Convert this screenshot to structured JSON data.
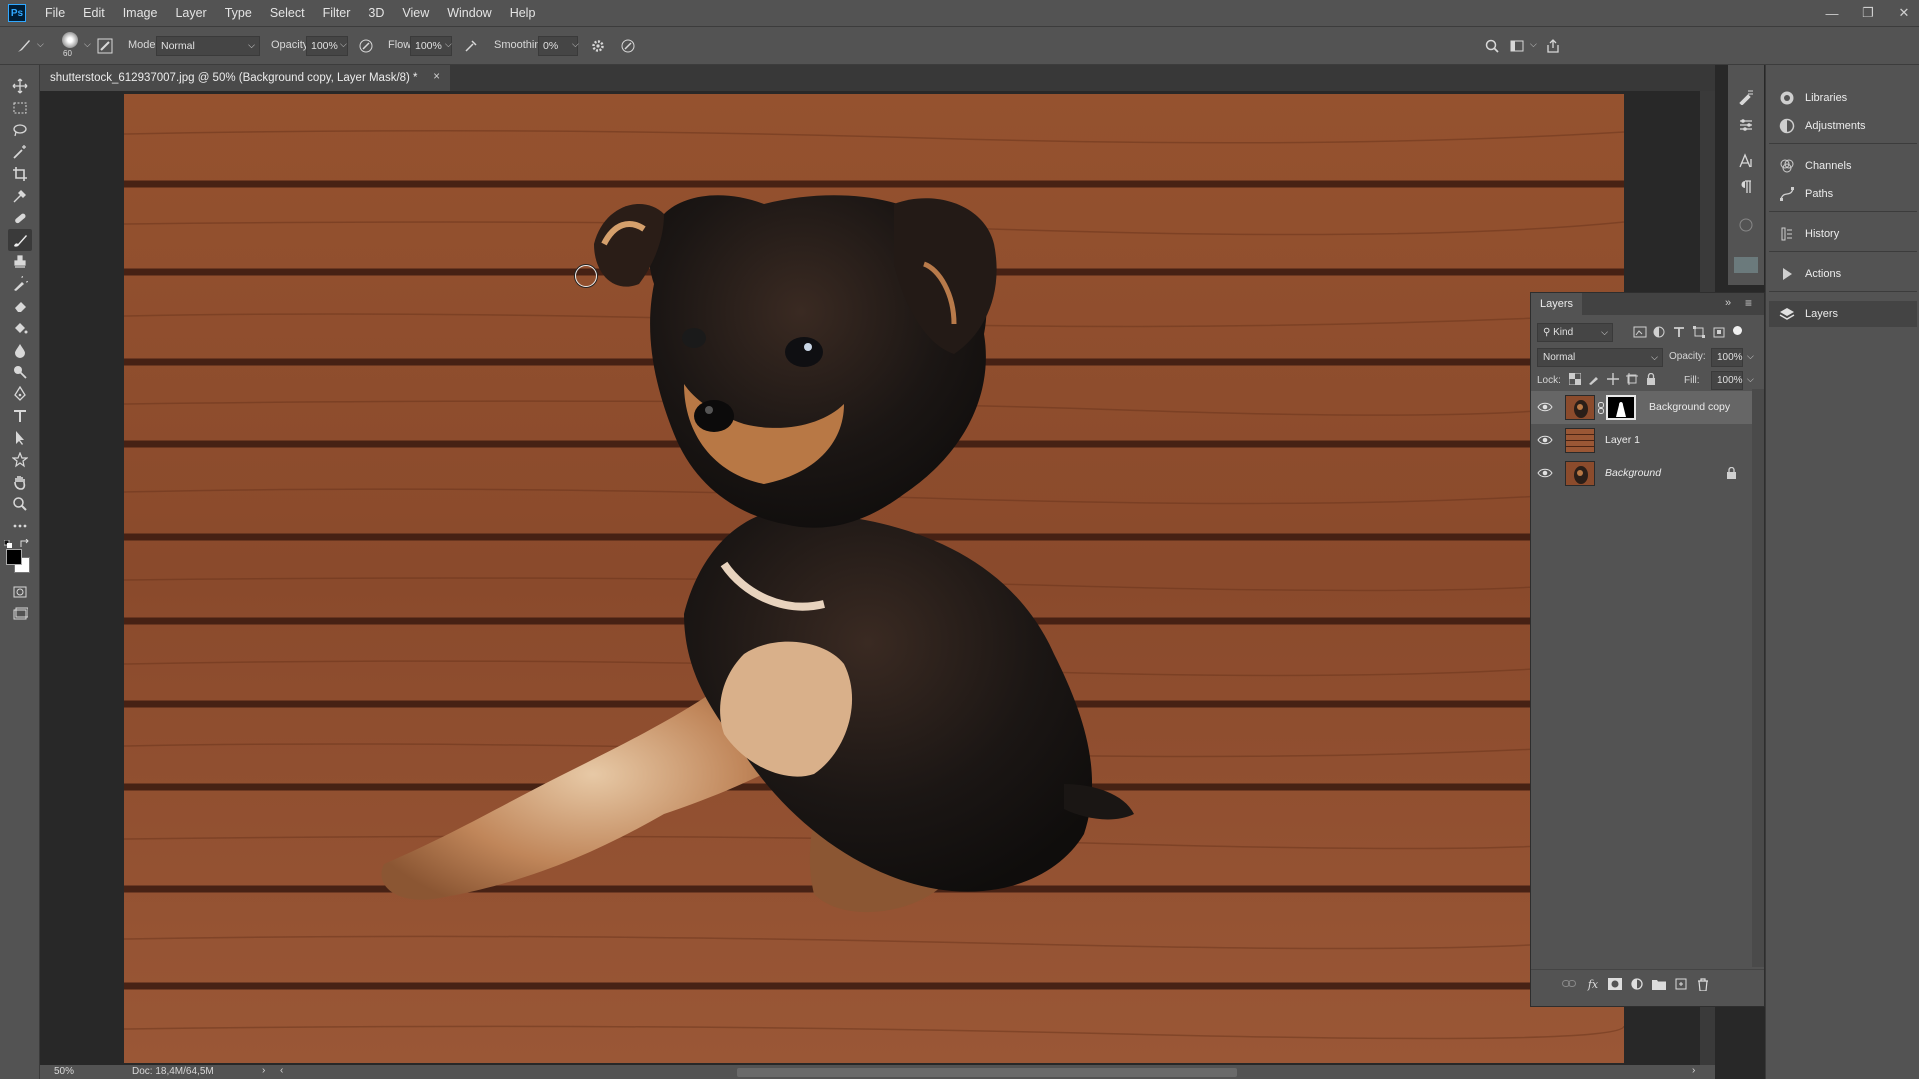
{
  "app": {
    "logo": "Ps",
    "menu": [
      "File",
      "Edit",
      "Image",
      "Layer",
      "Type",
      "Select",
      "Filter",
      "3D",
      "View",
      "Window",
      "Help"
    ]
  },
  "options": {
    "brush_size": "60",
    "mode_label": "Mode:",
    "mode_value": "Normal",
    "opacity_label": "Opacity:",
    "opacity_value": "100%",
    "flow_label": "Flow:",
    "flow_value": "100%",
    "smoothing_label": "Smoothing:",
    "smoothing_value": "0%"
  },
  "document": {
    "tab_title": "shutterstock_612937007.jpg @ 50% (Background copy, Layer Mask/8) *",
    "close": "×"
  },
  "status": {
    "zoom": "50%",
    "doc": "Doc: 18,4M/64,5M"
  },
  "panels": {
    "collapsed": [
      {
        "label": "Libraries",
        "icon": "libraries-icon"
      },
      {
        "label": "Adjustments",
        "icon": "adjustments-icon"
      },
      {
        "label": "Channels",
        "icon": "channels-icon"
      },
      {
        "label": "Paths",
        "icon": "paths-icon"
      },
      {
        "label": "History",
        "icon": "history-icon"
      },
      {
        "label": "Actions",
        "icon": "actions-icon"
      },
      {
        "label": "Layers",
        "icon": "layers-icon"
      }
    ]
  },
  "layers_panel": {
    "title": "Layers",
    "filter_kind": "Kind",
    "blend_mode": "Normal",
    "opacity_label": "Opacity:",
    "opacity_value": "100%",
    "lock_label": "Lock:",
    "fill_label": "Fill:",
    "fill_value": "100%",
    "layers": [
      {
        "name": "Background copy",
        "visible": true,
        "selected": true,
        "has_mask": true,
        "locked": false
      },
      {
        "name": "Layer 1",
        "visible": true,
        "selected": false,
        "has_mask": false,
        "locked": false
      },
      {
        "name": "Background",
        "visible": true,
        "selected": false,
        "has_mask": false,
        "locked": true
      }
    ]
  },
  "colors": {
    "chrome": "#535353",
    "chrome_dark": "#383838",
    "canvas_bg": "#282828",
    "wood": "#8a4a2c",
    "accent": "#31a8ff"
  }
}
